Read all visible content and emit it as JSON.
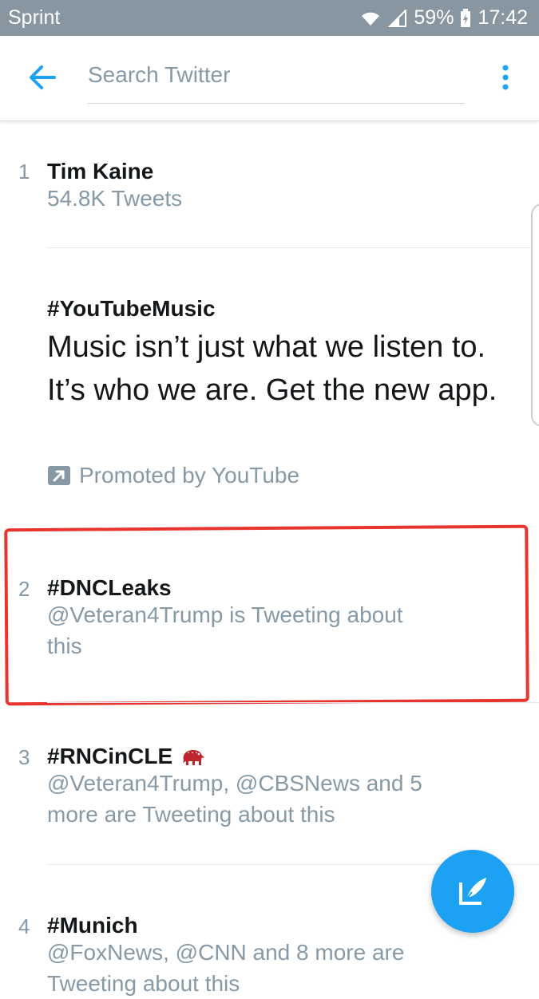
{
  "status_bar": {
    "carrier": "Sprint",
    "battery": "59%",
    "time": "17:42"
  },
  "header": {
    "search_placeholder": "Search Twitter",
    "accent_color": "#1da1f2"
  },
  "trends": [
    {
      "rank": "1",
      "title": "Tim Kaine",
      "subtitle": "54.8K Tweets"
    },
    {
      "promoted": true,
      "title": "#YouTubeMusic",
      "text": "Music isn’t just what we listen to. It’s who we are. Get the new app.",
      "promoted_by": "Promoted by YouTube"
    },
    {
      "rank": "2",
      "title": "#DNCLeaks",
      "subtitle": "@Veteran4Trump is Tweeting about this"
    },
    {
      "rank": "3",
      "title": "#RNCinCLE",
      "subtitle": "@Veteran4Trump, @CBSNews and 5 more are Tweeting about this"
    },
    {
      "rank": "4",
      "title": "#Munich",
      "subtitle": "@FoxNews, @CNN and 8 more are Tweeting about this"
    }
  ],
  "icons": {
    "back": "arrow-left-icon",
    "overflow": "more-vertical-icon",
    "promoted": "promoted-arrow-icon",
    "hashflag": "elephant-icon",
    "compose": "compose-tweet-icon"
  },
  "annotation_color": "#e8342f"
}
